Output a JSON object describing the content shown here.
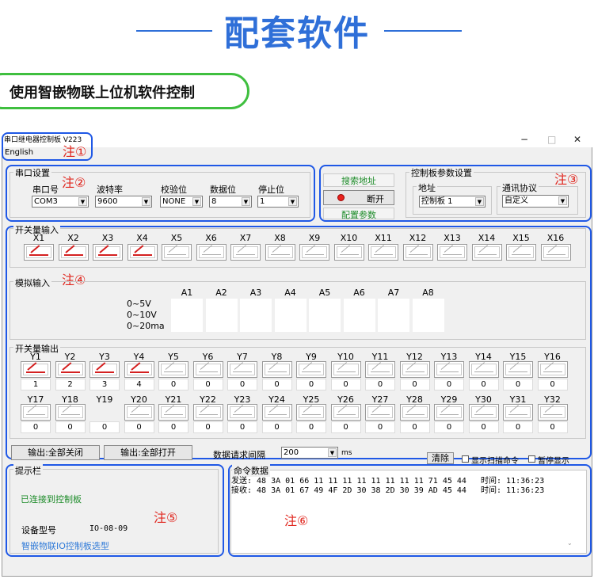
{
  "banner": {
    "title": "配套软件",
    "subtitle": "使用智嵌物联上位机软件控制"
  },
  "window": {
    "title": "串口继电器控制板 V223",
    "language_menu": "English",
    "controls": {
      "minimize": "−",
      "maximize": "□",
      "close": "✕"
    }
  },
  "annotations": [
    "注①",
    "注②",
    "注③",
    "注④",
    "注⑤",
    "注⑥"
  ],
  "serial": {
    "group_label": "串口设置",
    "fields": [
      {
        "label": "串口号",
        "value": "COM3"
      },
      {
        "label": "波特率",
        "value": "9600"
      },
      {
        "label": "校验位",
        "value": "NONE"
      },
      {
        "label": "数据位",
        "value": "8"
      },
      {
        "label": "停止位",
        "value": "1"
      }
    ]
  },
  "connect": {
    "search_label": "搜索地址",
    "disconnect_label": "断开",
    "config_label": "配置参数"
  },
  "board_params": {
    "group_label": "控制板参数设置",
    "address_label": "地址",
    "address_value": "控制板 1",
    "protocol_label": "通讯协议",
    "protocol_value": "自定义"
  },
  "inputs": {
    "group_label": "开关量输入",
    "channels": [
      "X1",
      "X2",
      "X3",
      "X4",
      "X5",
      "X6",
      "X7",
      "X8",
      "X9",
      "X10",
      "X11",
      "X12",
      "X13",
      "X14",
      "X15",
      "X16"
    ],
    "on_count": 4
  },
  "analog": {
    "group_label": "模拟输入",
    "columns": [
      "A1",
      "A2",
      "A3",
      "A4",
      "A5",
      "A6",
      "A7",
      "A8"
    ],
    "rows": [
      "0~5V",
      "0~10V",
      "0~20ma"
    ]
  },
  "outputs": {
    "group_label": "开关量输出",
    "row1": {
      "channels": [
        "Y1",
        "Y2",
        "Y3",
        "Y4",
        "Y5",
        "Y6",
        "Y7",
        "Y8",
        "Y9",
        "Y10",
        "Y11",
        "Y12",
        "Y13",
        "Y14",
        "Y15",
        "Y16"
      ],
      "counts": [
        "1",
        "2",
        "3",
        "4",
        "0",
        "0",
        "0",
        "0",
        "0",
        "0",
        "0",
        "0",
        "0",
        "0",
        "0",
        "0"
      ],
      "on_count": 4
    },
    "row2": {
      "channels": [
        "Y17",
        "Y18",
        "Y19",
        "Y20",
        "Y21",
        "Y22",
        "Y23",
        "Y24",
        "Y25",
        "Y26",
        "Y27",
        "Y28",
        "Y29",
        "Y30",
        "Y31",
        "Y32"
      ],
      "counts": [
        "0",
        "0",
        "0",
        "0",
        "0",
        "0",
        "0",
        "0",
        "0",
        "0",
        "0",
        "0",
        "0",
        "0",
        "0",
        "0"
      ]
    }
  },
  "bottom_bar": {
    "all_off_label": "输出:全部关闭",
    "all_on_label": "输出:全部打开",
    "interval_label": "数据请求间隔",
    "interval_value": "200",
    "interval_unit": "ms",
    "clear_label": "清除",
    "show_scan_label": "显示扫描命令",
    "pause_label": "暂停显示"
  },
  "hint_panel": {
    "group_label": "提示栏",
    "status": "已连接到控制板",
    "model_label": "设备型号",
    "model_value": "IO-08-09",
    "link_text": "智嵌物联IO控制板选型"
  },
  "command_panel": {
    "group_label": "命令数据",
    "send_line": "发送: 48 3A 01 66 11 11 11 11 11 11 11 11 71 45 44   时间: 11:36:23",
    "recv_line": "接收: 48 3A 01 67 49 4F 2D 30 38 2D 30 39 AD 45 44   时间: 11:36:23"
  }
}
